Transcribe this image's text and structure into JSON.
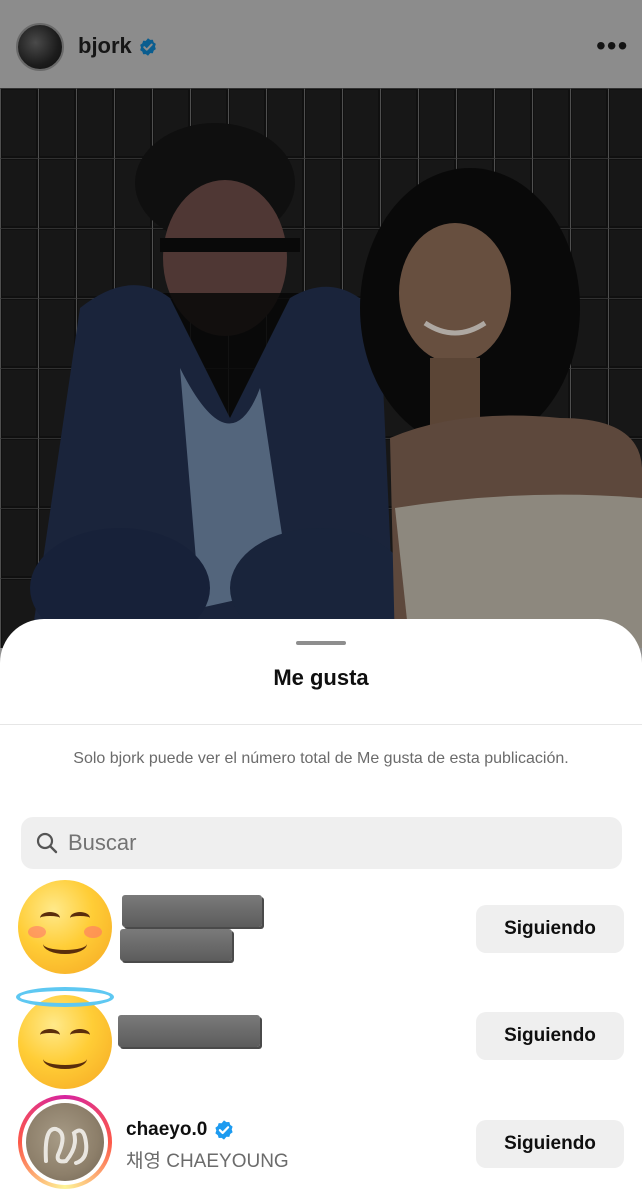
{
  "post": {
    "username": "bjork",
    "more_label": "•••"
  },
  "sheet": {
    "title": "Me gusta",
    "notice": "Solo bjork puede ver el número total de Me gusta de esta publicación.",
    "search_placeholder": "Buscar"
  },
  "likers": [
    {
      "avatar": "smiling-face-emoji",
      "name_redacted": true,
      "button_label": "Siguiendo"
    },
    {
      "avatar": "halo-face-emoji",
      "name_redacted": true,
      "button_label": "Siguiendo"
    },
    {
      "avatar": "profile-photo",
      "username": "chaeyo.0",
      "full_name": "채영 CHAEYOUNG",
      "verified": true,
      "button_label": "Siguiendo"
    }
  ],
  "colors": {
    "verified_blue": "#1d9bf0",
    "button_bg": "#efefef",
    "overlay_dim": "#8c8c8c"
  }
}
